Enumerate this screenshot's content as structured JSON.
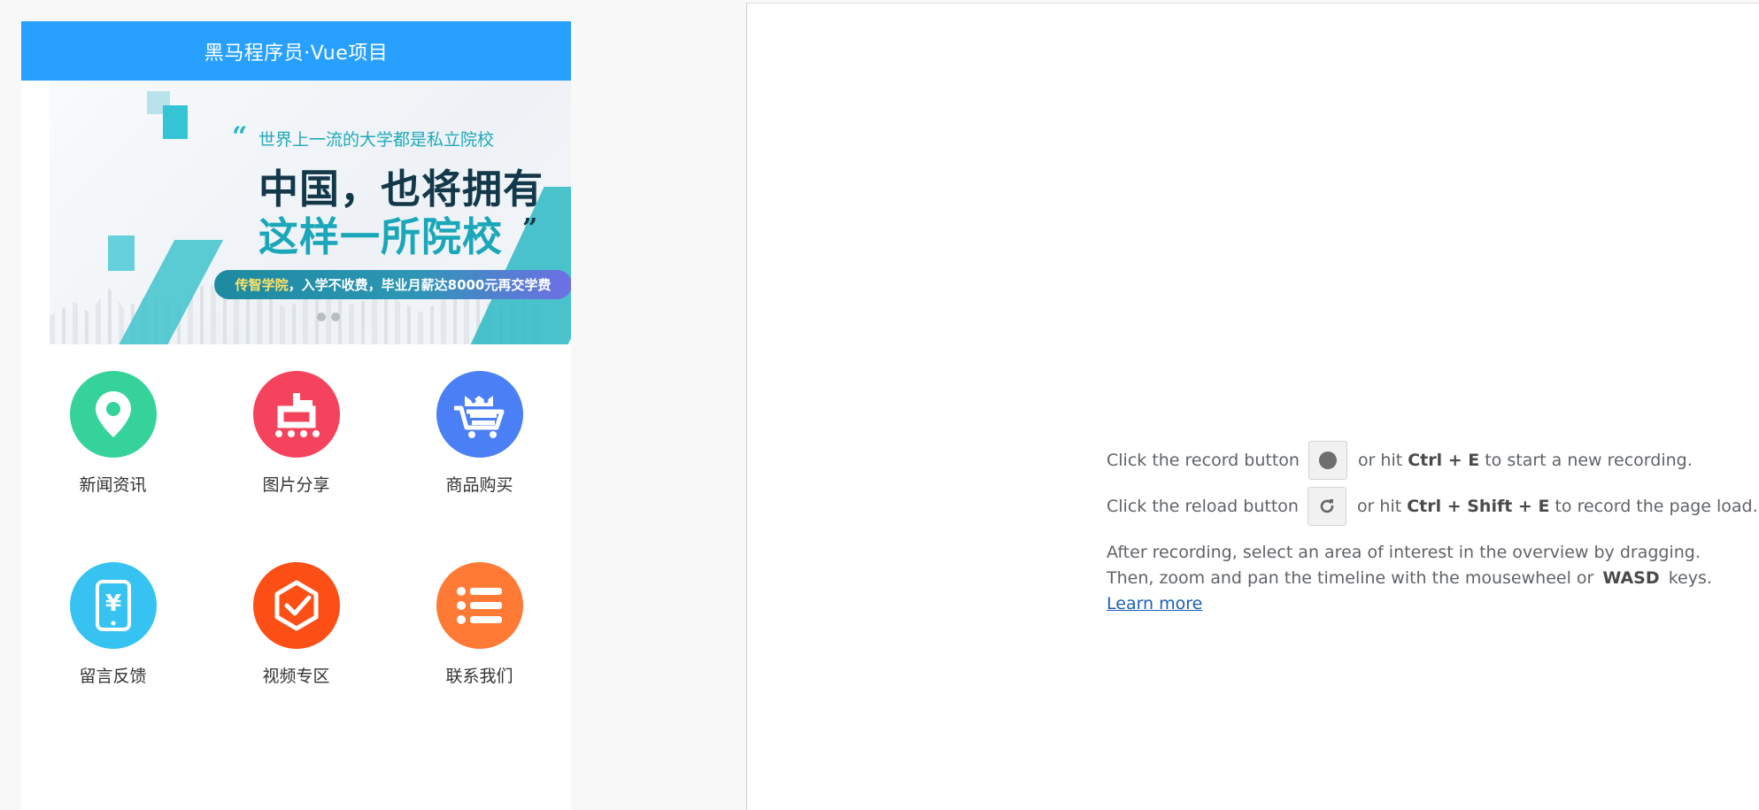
{
  "app": {
    "header_title": "黑马程序员·Vue项目",
    "banner": {
      "tagline": "世界上一流的大学都是私立院校",
      "headline_line1": "中国，也将拥有",
      "headline_line2": "这样一所院校",
      "pill_highlight": "传智学院",
      "pill_text": "，入学不收费，毕业月薪达8000元再交学费"
    },
    "tiles": [
      {
        "label": "新闻资讯",
        "icon": "location-pin-icon",
        "color": "#35d39a"
      },
      {
        "label": "图片分享",
        "icon": "dian-logo-icon",
        "color": "#f6435d"
      },
      {
        "label": "商品购买",
        "icon": "shopping-cart-icon",
        "color": "#4a7ff5"
      },
      {
        "label": "留言反馈",
        "icon": "phone-yen-icon",
        "color": "#37c3f2"
      },
      {
        "label": "视频专区",
        "icon": "hexagon-check-icon",
        "color": "#fb4f16"
      },
      {
        "label": "联系我们",
        "icon": "list-icon",
        "color": "#ff7a35"
      }
    ]
  },
  "devtools": {
    "record_prefix": "Click the record button",
    "record_mid": "or hit",
    "record_keys": "Ctrl + E",
    "record_suffix": "to start a new recording.",
    "reload_prefix": "Click the reload button",
    "reload_mid": "or hit",
    "reload_keys": "Ctrl + Shift + E",
    "reload_suffix": "to record the page load.",
    "para_line1": "After recording, select an area of interest in the overview by dragging.",
    "para_line2_prefix": "Then, zoom and pan the timeline with the mousewheel or",
    "para_line2_keys": "WASD",
    "para_line2_suffix": "keys.",
    "learn_more": "Learn more"
  }
}
